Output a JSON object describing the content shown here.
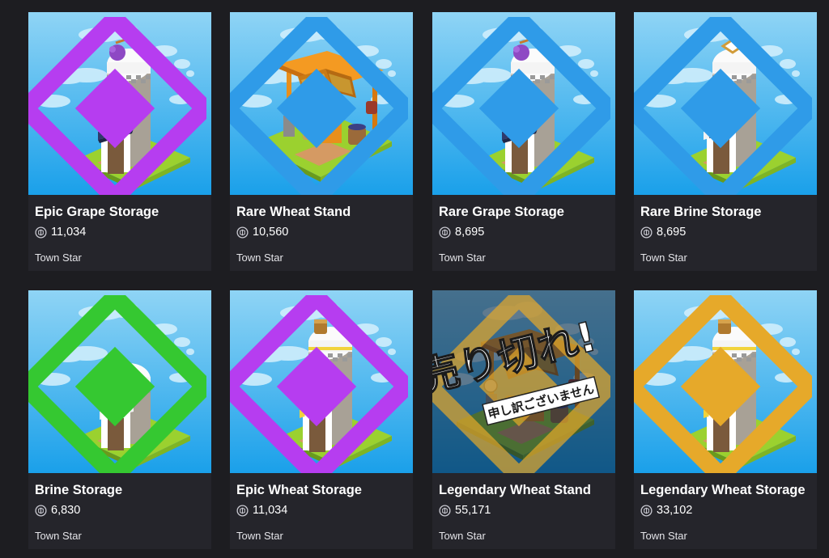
{
  "items": [
    {
      "name": "Epic Grape Storage",
      "price": "11,034",
      "game": "Town Star",
      "rarity": "epic",
      "rarity_color": "#b63df0",
      "icon": "grape-storage-icon"
    },
    {
      "name": "Rare Wheat Stand",
      "price": "10,560",
      "game": "Town Star",
      "rarity": "rare",
      "rarity_color": "#2f9be8",
      "icon": "wheat-stand-icon"
    },
    {
      "name": "Rare Grape Storage",
      "price": "8,695",
      "game": "Town Star",
      "rarity": "rare",
      "rarity_color": "#2f9be8",
      "icon": "grape-storage-icon"
    },
    {
      "name": "Rare Brine Storage",
      "price": "8,695",
      "game": "Town Star",
      "rarity": "rare",
      "rarity_color": "#2f9be8",
      "icon": "brine-storage-icon"
    },
    {
      "name": "Brine Storage",
      "price": "6,830",
      "game": "Town Star",
      "rarity": "uncommon",
      "rarity_color": "#35c831",
      "icon": "brine-storage-icon"
    },
    {
      "name": "Epic Wheat Storage",
      "price": "11,034",
      "game": "Town Star",
      "rarity": "epic",
      "rarity_color": "#b63df0",
      "icon": "wheat-storage-icon"
    },
    {
      "name": "Legendary Wheat Stand",
      "price": "55,171",
      "game": "Town Star",
      "rarity": "legendary",
      "rarity_color": "#e6a92a",
      "icon": "wheat-stand-icon",
      "sold_out_title": "売り切れ!",
      "sold_out_note": "申し訳ございません"
    },
    {
      "name": "Legendary Wheat Storage",
      "price": "33,102",
      "game": "Town Star",
      "rarity": "legendary",
      "rarity_color": "#e6a92a",
      "icon": "wheat-storage-icon"
    }
  ]
}
